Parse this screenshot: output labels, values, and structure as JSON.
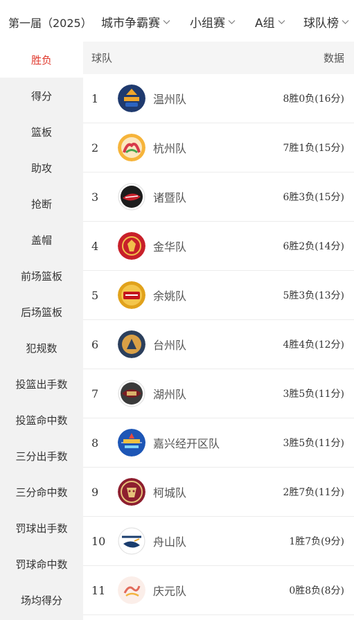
{
  "filters": {
    "season": "第一届（2025）",
    "competition": "城市争霸赛",
    "stage": "小组赛",
    "group": "A组",
    "board": "球队榜"
  },
  "sidebar": {
    "items": [
      {
        "label": "胜负",
        "active": true
      },
      {
        "label": "得分"
      },
      {
        "label": "篮板"
      },
      {
        "label": "助攻"
      },
      {
        "label": "抢断"
      },
      {
        "label": "盖帽"
      },
      {
        "label": "前场篮板"
      },
      {
        "label": "后场篮板"
      },
      {
        "label": "犯规数"
      },
      {
        "label": "投篮出手数"
      },
      {
        "label": "投篮命中数"
      },
      {
        "label": "三分出手数"
      },
      {
        "label": "三分命中数"
      },
      {
        "label": "罚球出手数"
      },
      {
        "label": "罚球命中数"
      },
      {
        "label": "场均得分"
      }
    ]
  },
  "table": {
    "col_team": "球队",
    "col_data": "数据",
    "rows": [
      {
        "rank": "1",
        "team": "温州队",
        "record": "8胜0负(16分)",
        "logo_icon": "wenzhou-logo-icon",
        "color": "#1f3a6e"
      },
      {
        "rank": "2",
        "team": "杭州队",
        "record": "7胜1负(15分)",
        "logo_icon": "hangzhou-logo-icon",
        "color": "#f3a531"
      },
      {
        "rank": "3",
        "team": "诸暨队",
        "record": "6胜3负(15分)",
        "logo_icon": "zhuji-logo-icon",
        "color": "#c8202a"
      },
      {
        "rank": "4",
        "team": "金华队",
        "record": "6胜2负(14分)",
        "logo_icon": "jinhua-logo-icon",
        "color": "#c8202a"
      },
      {
        "rank": "5",
        "team": "余姚队",
        "record": "5胜3负(13分)",
        "logo_icon": "yuyao-logo-icon",
        "color": "#e1a21b"
      },
      {
        "rank": "6",
        "team": "台州队",
        "record": "4胜4负(12分)",
        "logo_icon": "taizhou-logo-icon",
        "color": "#2b3f5c"
      },
      {
        "rank": "7",
        "team": "湖州队",
        "record": "3胜5负(11分)",
        "logo_icon": "huzhou-logo-icon",
        "color": "#5b1f22"
      },
      {
        "rank": "8",
        "team": "嘉兴经开区队",
        "record": "3胜5负(11分)",
        "logo_icon": "jiaxing-logo-icon",
        "color": "#1d56b6"
      },
      {
        "rank": "9",
        "team": "柯城队",
        "record": "2胜7负(11分)",
        "logo_icon": "kecheng-logo-icon",
        "color": "#8e1f2f"
      },
      {
        "rank": "10",
        "team": "舟山队",
        "record": "1胜7负(9分)",
        "logo_icon": "zhoushan-logo-icon",
        "color": "#1a3d6e"
      },
      {
        "rank": "11",
        "team": "庆元队",
        "record": "0胜8负(8分)",
        "logo_icon": "qingyuan-logo-icon",
        "color": "#e9b8b0"
      }
    ]
  },
  "colors": {
    "accent": "#e03a2e",
    "sidebar_bg": "#f2f2f2",
    "header_bg": "#f5f5f5"
  }
}
